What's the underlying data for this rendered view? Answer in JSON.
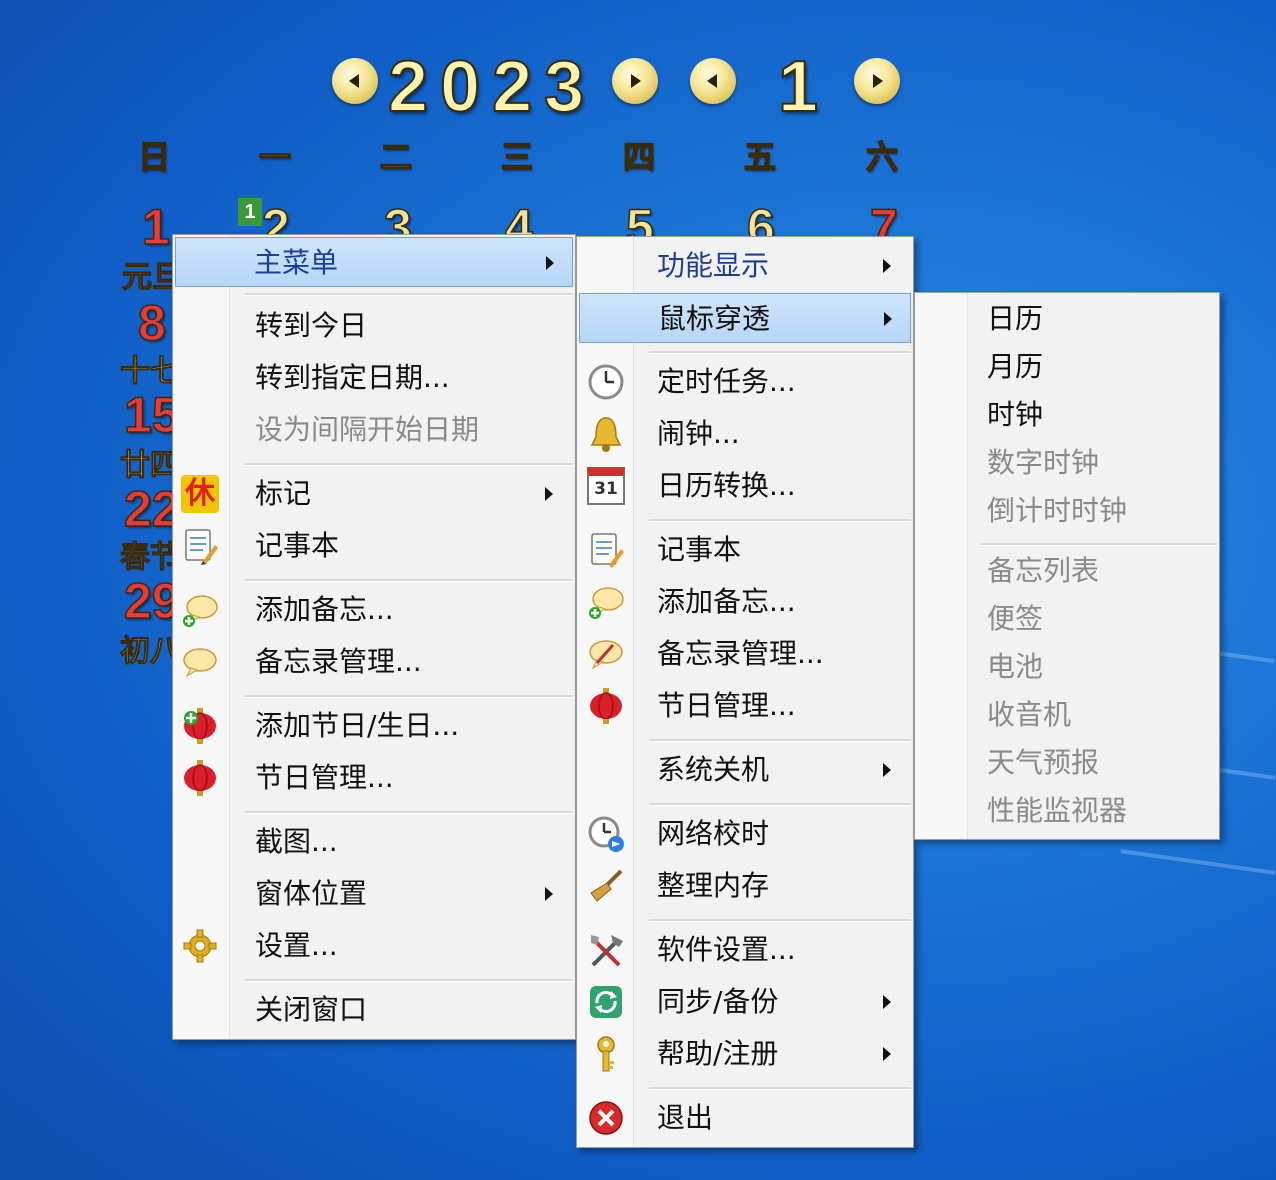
{
  "calendar": {
    "year": "2023",
    "month": "1",
    "weekdays": [
      "日",
      "一",
      "二",
      "三",
      "四",
      "五",
      "六"
    ],
    "days_row1": [
      "1",
      "2",
      "3",
      "4",
      "5",
      "6",
      "7"
    ],
    "today_badge": "1",
    "left_days": [
      "8",
      "15",
      "22",
      "29"
    ],
    "left_lunar": [
      "元旦",
      "十七",
      "廿四",
      "春节",
      "初八"
    ],
    "colors": {
      "weekend": "#e83a3a",
      "weekday": "#f4e49a",
      "lunar_blue": "#2f6fe0"
    }
  },
  "main_menu": {
    "title": "主菜单",
    "items": {
      "goto_today": "转到今日",
      "goto_date": "转到指定日期...",
      "set_interval_start": "设为间隔开始日期",
      "mark": "标记",
      "notepad": "记事本",
      "add_memo": "添加备忘...",
      "memo_manage": "备忘录管理...",
      "add_holiday": "添加节日/生日...",
      "holiday_manage": "节日管理...",
      "screenshot": "截图...",
      "window_position": "窗体位置",
      "settings": "设置...",
      "close_window": "关闭窗口"
    },
    "mark_icon_text": "休"
  },
  "func_menu": {
    "items": {
      "function_display": "功能显示",
      "mouse_passthrough": "鼠标穿透",
      "timed_task": "定时任务...",
      "alarm": "闹钟...",
      "calendar_convert": "日历转换...",
      "notepad": "记事本",
      "add_memo": "添加备忘...",
      "memo_manage": "备忘录管理...",
      "holiday_manage": "节日管理...",
      "system_shutdown": "系统关机",
      "network_time": "网络校时",
      "clean_memory": "整理内存",
      "software_settings": "软件设置...",
      "sync_backup": "同步/备份",
      "help_register": "帮助/注册",
      "exit": "退出"
    },
    "calendar_icon_text": "31"
  },
  "passthrough_menu": {
    "items": [
      "日历",
      "月历",
      "时钟",
      "数字时钟",
      "倒计时时钟",
      "备忘列表",
      "便签",
      "电池",
      "收音机",
      "天气预报",
      "性能监视器"
    ]
  }
}
